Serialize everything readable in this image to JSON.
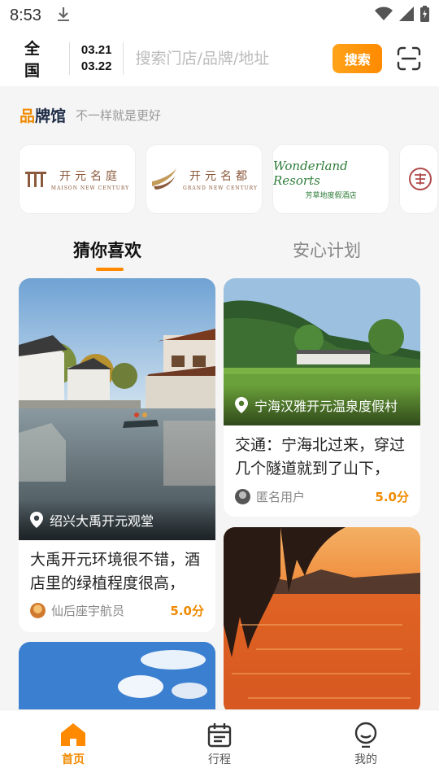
{
  "status_bar": {
    "time": "8:53"
  },
  "header": {
    "city": "全国",
    "date_start": "03.21",
    "date_end": "03.22",
    "search_placeholder": "搜索门店/品牌/地址",
    "search_button": "搜索"
  },
  "brand_section": {
    "logo_text_a": "品",
    "logo_text_b": "牌馆",
    "slogan": "不一样就是更好",
    "brands": [
      {
        "cn": "开元名庭",
        "en": "MAISON NEW CENTURY"
      },
      {
        "cn": "开元名都",
        "en": "GRAND NEW CENTURY"
      },
      {
        "en": "Wonderland Resorts",
        "cn": "芳草地度假酒店"
      }
    ]
  },
  "tabs": [
    "猜你喜欢",
    "安心计划"
  ],
  "feed": [
    {
      "location": "绍兴大禹开元观堂",
      "desc": "大禹开元环境很不错，酒店里的绿植程度很高，",
      "user": "仙后座宇航员",
      "score": "5.0分"
    },
    {
      "location": "宁海汉雅开元温泉度假村",
      "desc": "交通：宁海北过来，穿过几个隧道就到了山下，",
      "user": "匿名用户",
      "score": "5.0分"
    }
  ],
  "bottom_nav": [
    {
      "label": "首页",
      "icon": "home-icon"
    },
    {
      "label": "行程",
      "icon": "calendar-icon"
    },
    {
      "label": "我的",
      "icon": "profile-icon"
    }
  ],
  "colors": {
    "accent": "#ff8a00",
    "brand_dark": "#1f2d46"
  }
}
